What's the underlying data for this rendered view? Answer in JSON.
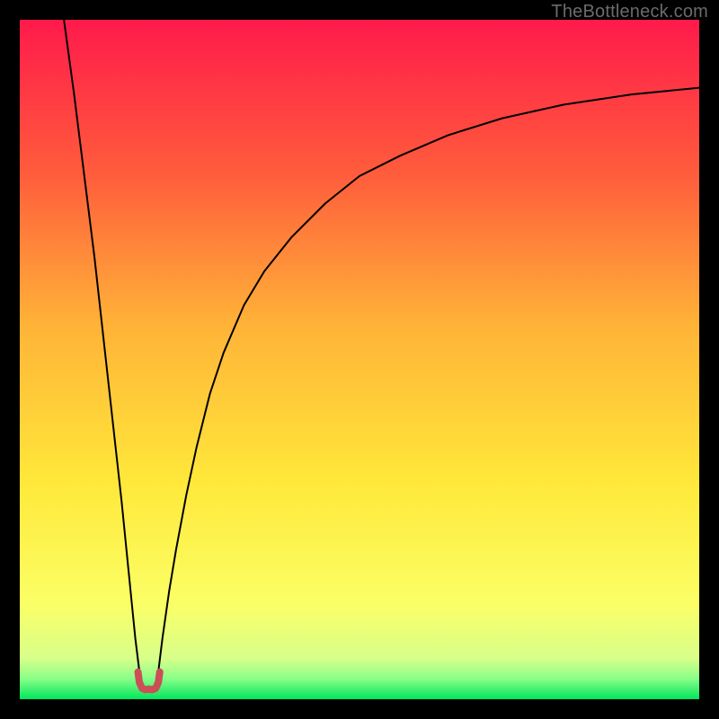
{
  "watermark": "TheBottleneck.com",
  "chart_data": {
    "type": "line",
    "title": "",
    "xlabel": "",
    "ylabel": "",
    "xlim": [
      0,
      100
    ],
    "ylim": [
      0,
      100
    ],
    "grid": false,
    "legend": false,
    "background_gradient_stops": [
      {
        "pct": 0,
        "color": "#ff1a4b"
      },
      {
        "pct": 22,
        "color": "#ff5a3c"
      },
      {
        "pct": 45,
        "color": "#ffb338"
      },
      {
        "pct": 68,
        "color": "#ffe83a"
      },
      {
        "pct": 86,
        "color": "#fbff66"
      },
      {
        "pct": 94,
        "color": "#d8ff8a"
      },
      {
        "pct": 97,
        "color": "#88ff88"
      },
      {
        "pct": 100,
        "color": "#00e65c"
      }
    ],
    "series": [
      {
        "name": "left-branch",
        "color": "#000000",
        "width": 2.0,
        "x": [
          6.5,
          8,
          9,
          10,
          11,
          12,
          13,
          14,
          15,
          16,
          17,
          17.8
        ],
        "y": [
          100,
          89,
          81,
          73,
          65,
          56,
          47,
          38,
          29,
          19,
          9,
          2.5
        ]
      },
      {
        "name": "right-branch",
        "color": "#000000",
        "width": 2.0,
        "x": [
          20.2,
          21,
          22,
          23,
          24.5,
          26,
          28,
          30,
          33,
          36,
          40,
          45,
          50,
          56,
          63,
          71,
          80,
          90,
          100
        ],
        "y": [
          2.5,
          9,
          16,
          22,
          30,
          37,
          45,
          51,
          58,
          63,
          68,
          73,
          77,
          80,
          83,
          85.5,
          87.5,
          89,
          90
        ]
      },
      {
        "name": "valley-marker",
        "color": "#cc4e57",
        "width": 8.0,
        "x": [
          17.4,
          17.6,
          18.0,
          18.5,
          19.0,
          19.5,
          20.0,
          20.4,
          20.6
        ],
        "y": [
          4.0,
          2.5,
          1.6,
          1.4,
          1.5,
          1.4,
          1.6,
          2.5,
          4.0
        ]
      }
    ]
  }
}
